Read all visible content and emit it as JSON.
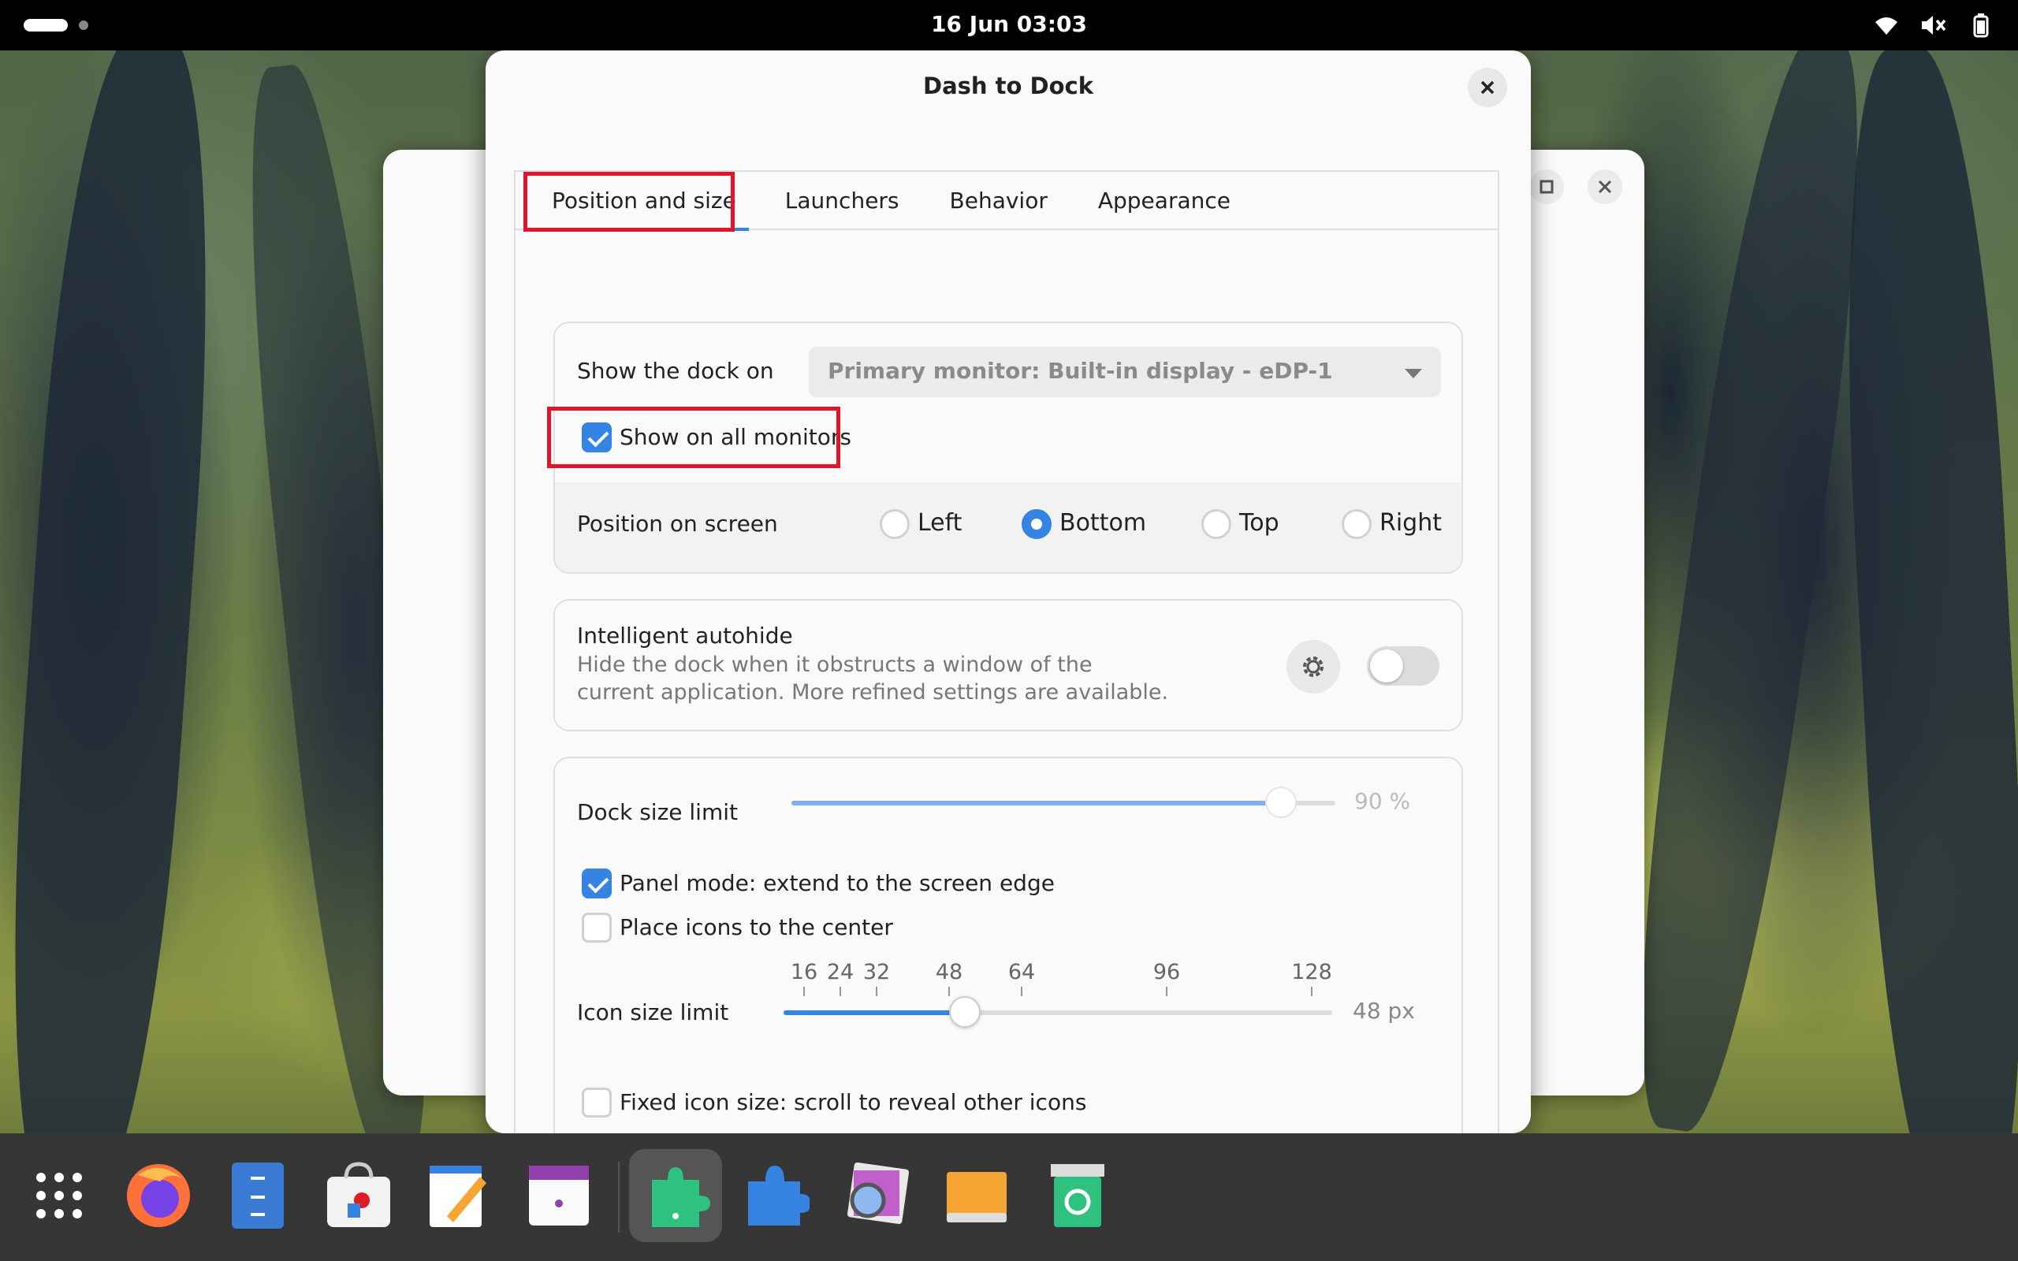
{
  "topbar": {
    "clock": "16 Jun  03:03",
    "icons": [
      "wifi-icon",
      "volume-muted-icon",
      "battery-icon"
    ]
  },
  "dialog": {
    "title": "Dash to Dock",
    "tabs": [
      {
        "label": "Position and size",
        "active": true
      },
      {
        "label": "Launchers",
        "active": false
      },
      {
        "label": "Behavior",
        "active": false
      },
      {
        "label": "Appearance",
        "active": false
      }
    ],
    "position_card": {
      "show_dock_on_label": "Show the dock on",
      "monitor_selected": "Primary monitor: Built-in display - eDP-1",
      "show_all_monitors_label": "Show on all monitors",
      "show_all_monitors_checked": true,
      "position_label": "Position on screen",
      "positions": [
        {
          "label": "Left",
          "selected": false
        },
        {
          "label": "Bottom",
          "selected": true
        },
        {
          "label": "Top",
          "selected": false
        },
        {
          "label": "Right",
          "selected": false
        }
      ]
    },
    "autohide_card": {
      "title": "Intelligent autohide",
      "subtitle_line1": "Hide the dock when it obstructs a window of the",
      "subtitle_line2": "current application. More refined settings are available.",
      "enabled": false
    },
    "size_card": {
      "dock_size_label": "Dock size limit",
      "dock_size_value": "90 %",
      "dock_size_fraction": 0.9,
      "panel_mode_label": "Panel mode: extend to the screen edge",
      "panel_mode_checked": true,
      "center_icons_label": "Place icons to the center",
      "center_icons_checked": false,
      "icon_size_label": "Icon size limit",
      "icon_size_marks": [
        "16",
        "24",
        "32",
        "48",
        "64",
        "96",
        "128"
      ],
      "icon_size_value": "48 px",
      "fixed_icon_label": "Fixed icon size: scroll to reveal other icons",
      "fixed_icon_checked": false
    }
  },
  "annotation_color": "#e0152c",
  "accent_color": "#3584e4",
  "dock": {
    "items": [
      "app-grid-icon",
      "firefox-icon",
      "files-icon",
      "software-icon",
      "text-editor-icon",
      "calendar-icon",
      "extensions-icon",
      "extension-manager-icon",
      "image-viewer-icon",
      "drive-icon",
      "trash-icon"
    ]
  }
}
